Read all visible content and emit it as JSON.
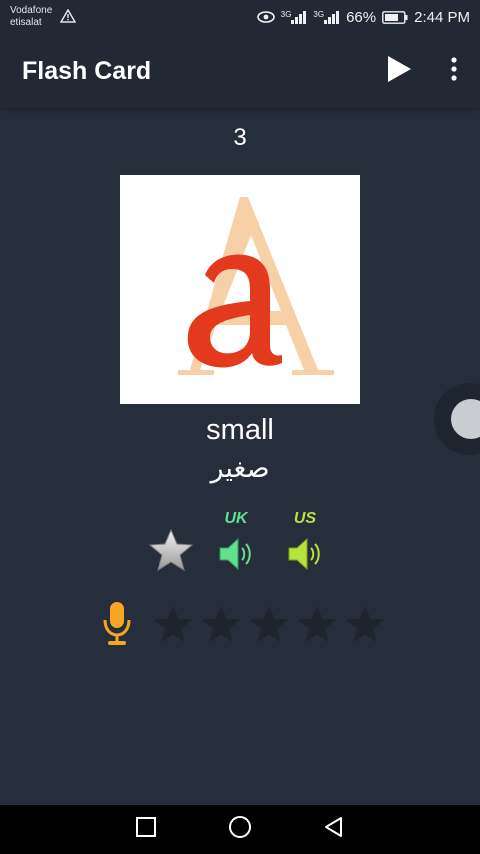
{
  "status_bar": {
    "carrier_line1": "Vodafone",
    "carrier_line2": "etisalat",
    "network1": "3G",
    "network2": "3G",
    "battery": "66%",
    "time": "2:44 PM"
  },
  "app_bar": {
    "title": "Flash Card",
    "play_icon": "play-icon",
    "menu_icon": "more-vert-icon"
  },
  "card": {
    "number": "3",
    "image_icon": "letter-a-image",
    "word": "small",
    "translation": "صغير"
  },
  "audio": {
    "uk_label": "UK",
    "us_label": "US",
    "uk_color": "#62e08f",
    "us_color": "#b4e33c"
  },
  "rating": {
    "stars_total": 5,
    "stars_filled": 0
  },
  "colors": {
    "background": "#272e3b",
    "appbar": "#222934",
    "mic": "#f6a623"
  }
}
